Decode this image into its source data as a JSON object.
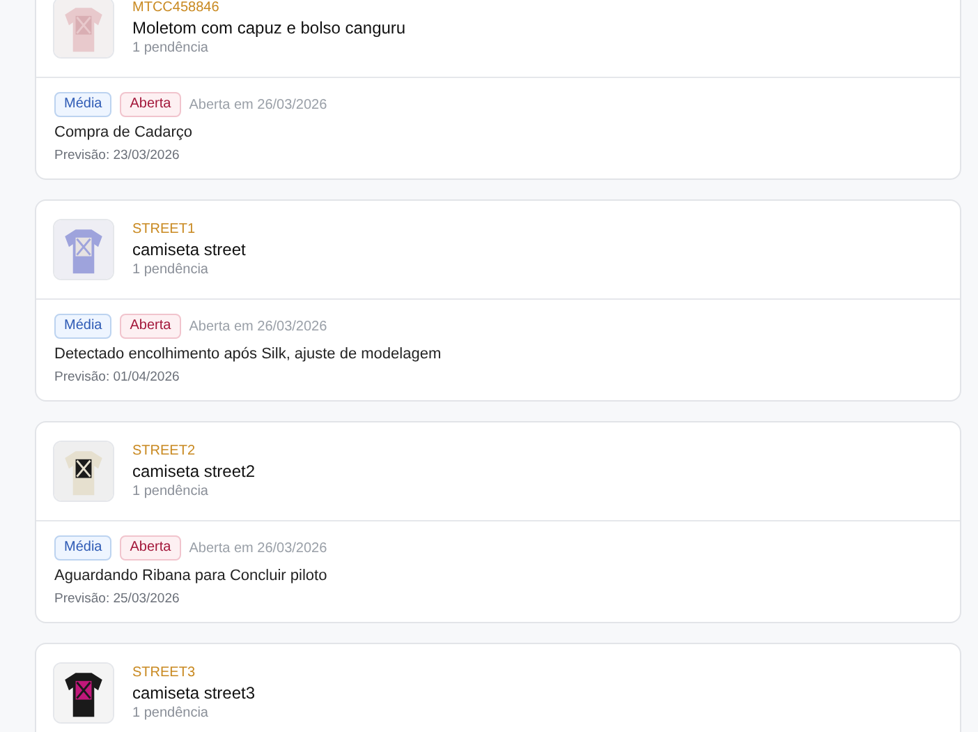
{
  "products": [
    {
      "code": "MTCC458846",
      "name": "Moletom com capuz e bolso canguru",
      "pending": "1 pendência",
      "issues": [
        {
          "tags": [
            {
              "label": "Média",
              "kind": "priority"
            },
            {
              "label": "Aberta",
              "kind": "status"
            }
          ],
          "opened": "Aberta em 26/03/2026",
          "description": "Compra de Cadarço",
          "forecast": "Previsão: 23/03/2026"
        }
      ]
    },
    {
      "code": "STREET1",
      "name": "camiseta street",
      "pending": "1 pendência",
      "issues": [
        {
          "tags": [
            {
              "label": "Média",
              "kind": "priority"
            },
            {
              "label": "Aberta",
              "kind": "status"
            }
          ],
          "opened": "Aberta em 26/03/2026",
          "description": "Detectado encolhimento após Silk, ajuste de modelagem",
          "forecast": "Previsão: 01/04/2026"
        }
      ]
    },
    {
      "code": "STREET2",
      "name": "camiseta street2",
      "pending": "1 pendência",
      "issues": [
        {
          "tags": [
            {
              "label": "Média",
              "kind": "priority"
            },
            {
              "label": "Aberta",
              "kind": "status"
            }
          ],
          "opened": "Aberta em 26/03/2026",
          "description": "Aguardando Ribana para Concluir piloto",
          "forecast": "Previsão: 25/03/2026"
        }
      ]
    },
    {
      "code": "STREET3",
      "name": "camiseta street3",
      "pending": "1 pendência"
    }
  ]
}
